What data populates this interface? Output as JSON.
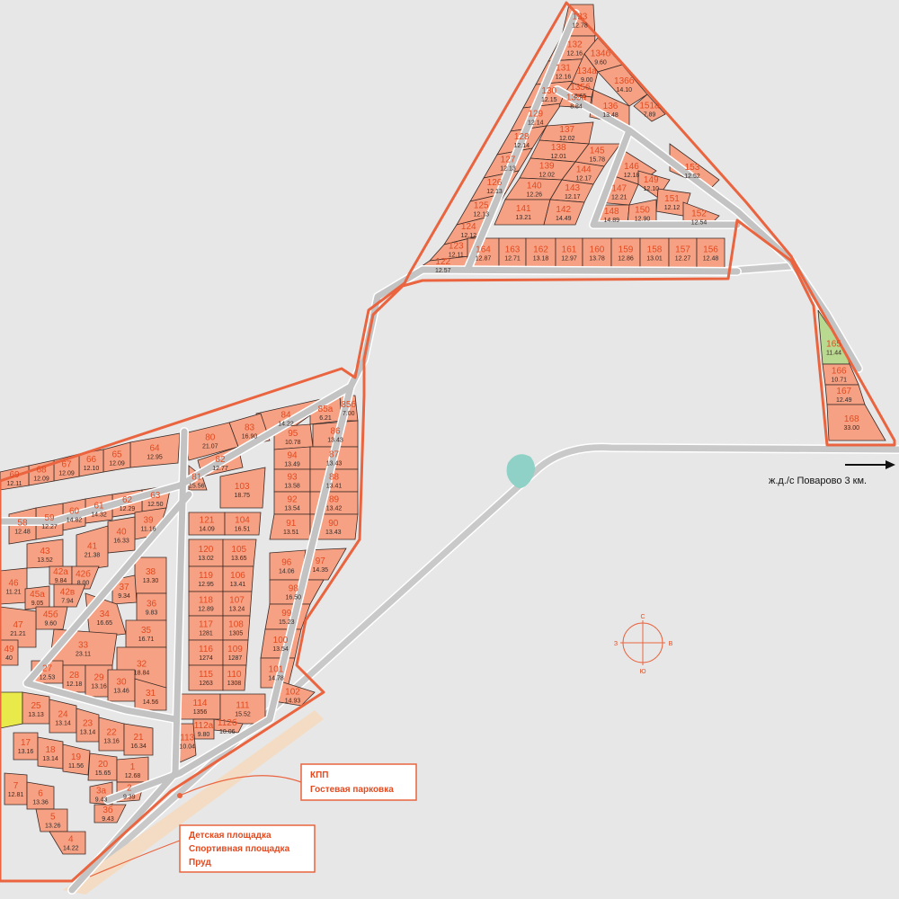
{
  "plots": [
    {
      "n": "133",
      "a": "12.78"
    },
    {
      "n": "132",
      "a": "12.16"
    },
    {
      "n": "131",
      "a": "12.16"
    },
    {
      "n": "130",
      "a": "12.15"
    },
    {
      "n": "129",
      "a": "12.14"
    },
    {
      "n": "128",
      "a": "12.14"
    },
    {
      "n": "127",
      "a": "12.13"
    },
    {
      "n": "126",
      "a": "12.13"
    },
    {
      "n": "125",
      "a": "12.13"
    },
    {
      "n": "124",
      "a": "12.12"
    },
    {
      "n": "123",
      "a": "12.11"
    },
    {
      "n": "122",
      "a": "12.57"
    },
    {
      "n": "134б",
      "a": "9.60"
    },
    {
      "n": "134а",
      "a": "9.00"
    },
    {
      "n": "135б",
      "a": "8.65"
    },
    {
      "n": "135а",
      "a": "8.84"
    },
    {
      "n": "136б",
      "a": "14.10"
    },
    {
      "n": "136",
      "a": "13.48"
    },
    {
      "n": "151а",
      "a": "7.89"
    },
    {
      "n": "137",
      "a": "12.02"
    },
    {
      "n": "138",
      "a": "12.01"
    },
    {
      "n": "145",
      "a": "15.78"
    },
    {
      "n": "139",
      "a": "12.02"
    },
    {
      "n": "144",
      "a": "12.17"
    },
    {
      "n": "140",
      "a": "12.26"
    },
    {
      "n": "143",
      "a": "12.17"
    },
    {
      "n": "141",
      "a": "13.21"
    },
    {
      "n": "142",
      "a": "14.49"
    },
    {
      "n": "146",
      "a": "12.18"
    },
    {
      "n": "147",
      "a": "12.21"
    },
    {
      "n": "149",
      "a": "12.10"
    },
    {
      "n": "148",
      "a": "14.89"
    },
    {
      "n": "150",
      "a": "12.90"
    },
    {
      "n": "151",
      "a": "12.12"
    },
    {
      "n": "152",
      "a": "12.54"
    },
    {
      "n": "153",
      "a": "12.52"
    },
    {
      "n": "164",
      "a": "12.87"
    },
    {
      "n": "163",
      "a": "12.71"
    },
    {
      "n": "162",
      "a": "13.18"
    },
    {
      "n": "161",
      "a": "12.97"
    },
    {
      "n": "160",
      "a": "13.78"
    },
    {
      "n": "159",
      "a": "12.86"
    },
    {
      "n": "158",
      "a": "13.01"
    },
    {
      "n": "157",
      "a": "12.27"
    },
    {
      "n": "156",
      "a": "12.48"
    },
    {
      "n": "165",
      "a": "11.44"
    },
    {
      "n": "166",
      "a": "10.71"
    },
    {
      "n": "167",
      "a": "12.49"
    },
    {
      "n": "168",
      "a": "33.00"
    },
    {
      "n": "84",
      "a": "14.22"
    },
    {
      "n": "83",
      "a": "16.90"
    },
    {
      "n": "80",
      "a": "21.07"
    },
    {
      "n": "82",
      "a": "12.77"
    },
    {
      "n": "81",
      "a": "15.56"
    },
    {
      "n": "85а",
      "a": "6.21"
    },
    {
      "n": "85б",
      "a": "7.00"
    },
    {
      "n": "95",
      "a": "10.78"
    },
    {
      "n": "86",
      "a": "13.43"
    },
    {
      "n": "94",
      "a": "13.49"
    },
    {
      "n": "87",
      "a": "13.43"
    },
    {
      "n": "93",
      "a": "13.58"
    },
    {
      "n": "88",
      "a": "13.41"
    },
    {
      "n": "92",
      "a": "13.54"
    },
    {
      "n": "89",
      "a": "13.42"
    },
    {
      "n": "91",
      "a": "13.51"
    },
    {
      "n": "90",
      "a": "13.43"
    },
    {
      "n": "103",
      "a": "18.75"
    },
    {
      "n": "121",
      "a": "14.09"
    },
    {
      "n": "104",
      "a": "16.51"
    },
    {
      "n": "120",
      "a": "13.02"
    },
    {
      "n": "105",
      "a": "13.65"
    },
    {
      "n": "119",
      "a": "12.95"
    },
    {
      "n": "106",
      "a": "13.41"
    },
    {
      "n": "118",
      "a": "12.89"
    },
    {
      "n": "107",
      "a": "13.24"
    },
    {
      "n": "117",
      "a": "1281"
    },
    {
      "n": "108",
      "a": "1305"
    },
    {
      "n": "116",
      "a": "1274"
    },
    {
      "n": "109",
      "a": "1287"
    },
    {
      "n": "115",
      "a": "1263"
    },
    {
      "n": "110",
      "a": "1308"
    },
    {
      "n": "114",
      "a": "1356"
    },
    {
      "n": "111",
      "a": "15.52"
    },
    {
      "n": "112б",
      "a": "10.06"
    },
    {
      "n": "112а",
      "a": "9.80"
    },
    {
      "n": "113",
      "a": "10.04"
    },
    {
      "n": "96",
      "a": "14.06"
    },
    {
      "n": "97",
      "a": "14.35"
    },
    {
      "n": "98",
      "a": "16.50"
    },
    {
      "n": "99",
      "a": "15.23"
    },
    {
      "n": "100",
      "a": "13.54"
    },
    {
      "n": "101",
      "a": "14.78"
    },
    {
      "n": "102",
      "a": "14.93"
    },
    {
      "n": "64",
      "a": "12.95"
    },
    {
      "n": "65",
      "a": "12.09"
    },
    {
      "n": "66",
      "a": "12.10"
    },
    {
      "n": "67",
      "a": "12.09"
    },
    {
      "n": "68",
      "a": "12.09"
    },
    {
      "n": "69",
      "a": "12.11"
    },
    {
      "n": "63",
      "a": "12.50"
    },
    {
      "n": "62",
      "a": "12.29"
    },
    {
      "n": "61",
      "a": "14.32"
    },
    {
      "n": "60",
      "a": "14.82"
    },
    {
      "n": "59",
      "a": "12.27"
    },
    {
      "n": "58",
      "a": "12.48"
    },
    {
      "n": "39",
      "a": "11.16"
    },
    {
      "n": "40",
      "a": "16.33"
    },
    {
      "n": "41",
      "a": "21.38"
    },
    {
      "n": "43",
      "a": "13.52"
    },
    {
      "n": "42а",
      "a": "9.84"
    },
    {
      "n": "42б",
      "a": "8.00"
    },
    {
      "n": "42в",
      "a": "7.94"
    },
    {
      "n": "46",
      "a": "11.21"
    },
    {
      "n": "45а",
      "a": "9.05"
    },
    {
      "n": "45б",
      "a": "9.60"
    },
    {
      "n": "47",
      "a": "21.21"
    },
    {
      "n": "38",
      "a": "13.30"
    },
    {
      "n": "37",
      "a": "9.34"
    },
    {
      "n": "36",
      "a": "9.83"
    },
    {
      "n": "34",
      "a": "16.65"
    },
    {
      "n": "35",
      "a": "16.71"
    },
    {
      "n": "33",
      "a": "23.11"
    },
    {
      "n": "32",
      "a": "18.84"
    },
    {
      "n": "27",
      "a": "12.53"
    },
    {
      "n": "28",
      "a": "12.18"
    },
    {
      "n": "29",
      "a": "13.16"
    },
    {
      "n": "30",
      "a": "13.46"
    },
    {
      "n": "31",
      "a": "14.56"
    },
    {
      "n": "25",
      "a": "13.13"
    },
    {
      "n": "24",
      "a": "13.14"
    },
    {
      "n": "23",
      "a": "13.14"
    },
    {
      "n": "22",
      "a": "13.16"
    },
    {
      "n": "21",
      "a": "16.34"
    },
    {
      "n": "17",
      "a": "13.16"
    },
    {
      "n": "18",
      "a": "13.14"
    },
    {
      "n": "19",
      "a": "11.56"
    },
    {
      "n": "20",
      "a": "15.65"
    },
    {
      "n": "1",
      "a": "12.68"
    },
    {
      "n": "2",
      "a": "9.39"
    },
    {
      "n": "3а",
      "a": "9.43"
    },
    {
      "n": "3б",
      "a": "9.43"
    },
    {
      "n": "7",
      "a": "12.81"
    },
    {
      "n": "6",
      "a": "13.36"
    },
    {
      "n": "5",
      "a": "13.26"
    },
    {
      "n": "4",
      "a": "14.22"
    },
    {
      "n": "49",
      "a": "40"
    }
  ],
  "callouts": {
    "kpp": "КПП",
    "guest_parking": "Гостевая парковка",
    "playground": "Детская площадка",
    "sports_ground": "Спортивная площадка",
    "pond": "Пруд"
  },
  "rail_label": "ж.д./с Поварово 3 км.",
  "compass": {
    "n": "С",
    "s": "Ю",
    "w": "З",
    "e": "В"
  },
  "colors": {
    "plot": "#f6a184",
    "boundary": "#e9643f",
    "road": "#c3c3c3",
    "green": "#b8d98f",
    "water": "#8fd1c6",
    "background": "#e7e7e7"
  }
}
